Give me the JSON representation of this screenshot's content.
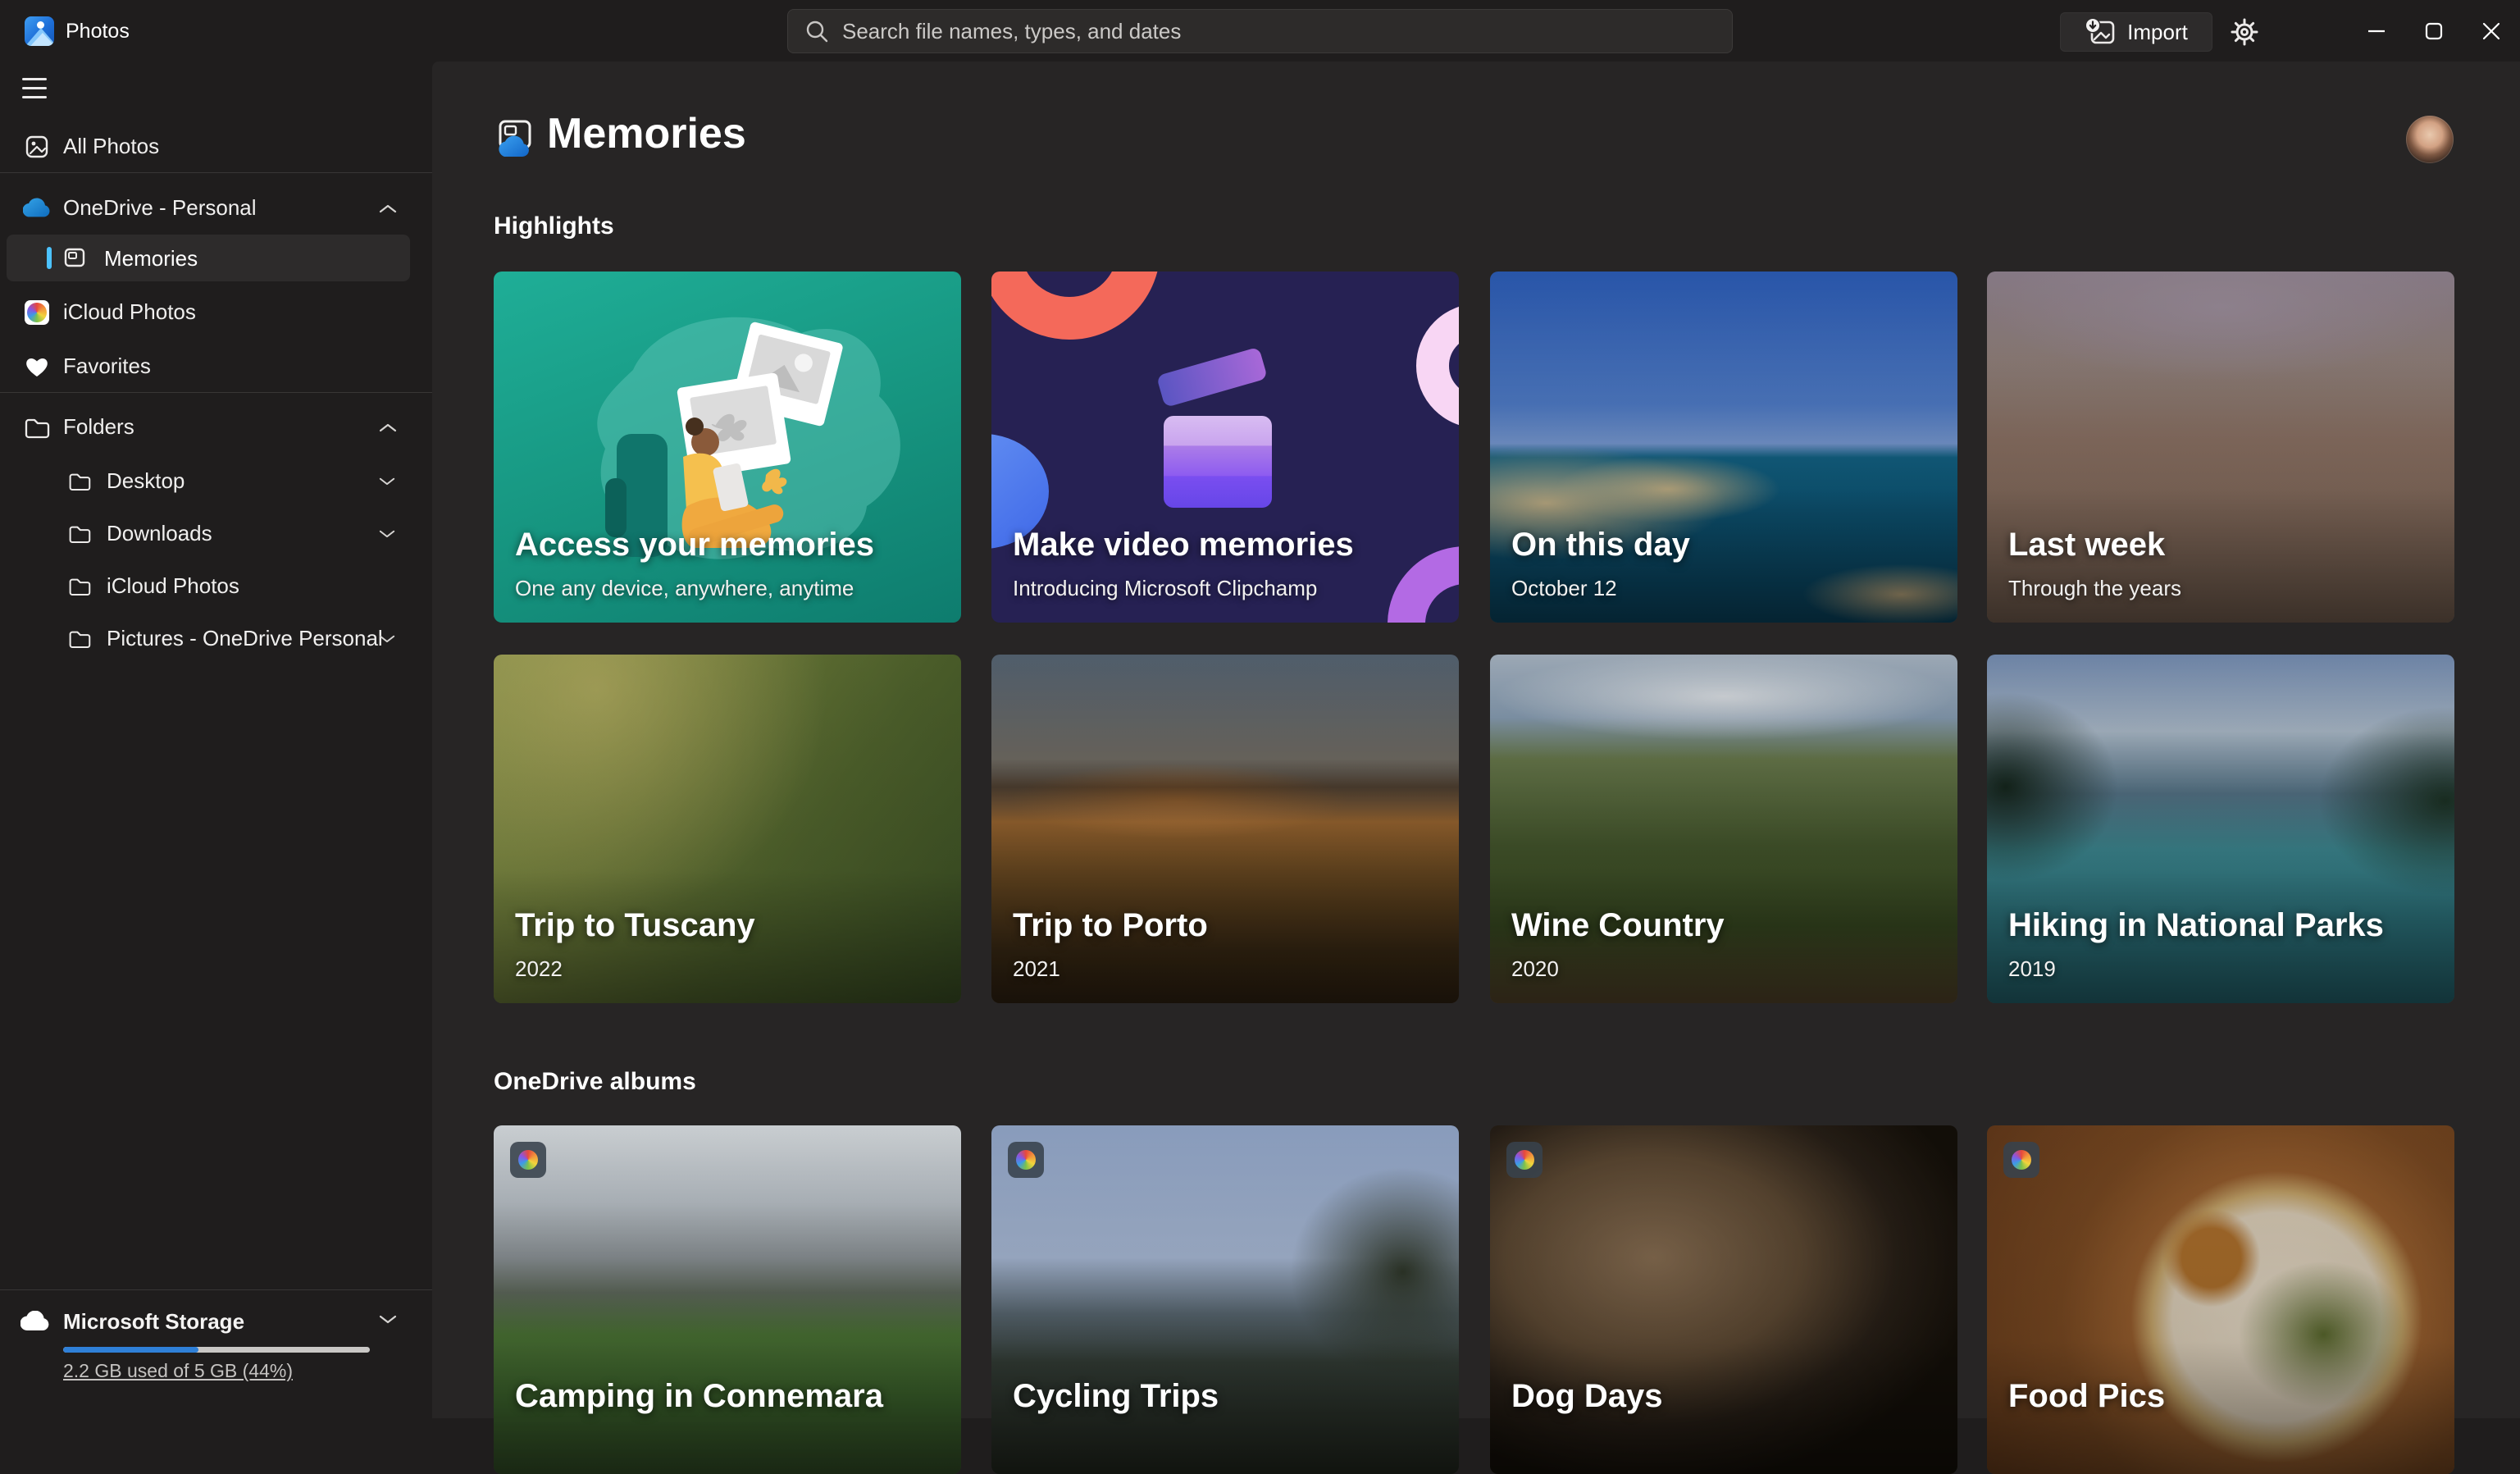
{
  "app": {
    "name": "Photos"
  },
  "titlebar": {
    "search": {
      "placeholder": "Search file names, types, and dates"
    },
    "import_button": {
      "label": "Import"
    }
  },
  "sidebar": {
    "items": {
      "all_photos": {
        "label": "All Photos"
      },
      "onedrive": {
        "label": "OneDrive - Personal",
        "expanded": true
      },
      "memories": {
        "label": "Memories",
        "selected": true
      },
      "icloud": {
        "label": "iCloud Photos"
      },
      "favorites": {
        "label": "Favorites"
      }
    },
    "folders": {
      "label": "Folders",
      "children": [
        {
          "label": "Desktop"
        },
        {
          "label": "Downloads"
        },
        {
          "label": "iCloud Photos"
        },
        {
          "label": "Pictures - OneDrive Personal"
        }
      ]
    },
    "storage": {
      "label": "Microsoft Storage",
      "usage": "2.2 GB used of 5 GB (44%)",
      "percent_used": 44,
      "bar_color": "#2f80d8"
    }
  },
  "page": {
    "title": "Memories",
    "highlights": {
      "label": "Highlights",
      "cards": [
        {
          "title": "Access your memories",
          "subtitle": "One any device, anywhere, anytime",
          "photo": "promo-onedrive-illustration"
        },
        {
          "title": "Make video memories",
          "subtitle": "Introducing Microsoft Clipchamp",
          "photo": "clipchamp-promo"
        },
        {
          "title": "On this day",
          "subtitle": "October 12",
          "photo": "coastal-cliffs-sea"
        },
        {
          "title": "Last week",
          "subtitle": "Through the years",
          "photo": "desert-trail-hiker"
        },
        {
          "title": "Trip to Tuscany",
          "subtitle": "2022",
          "photo": "tuscan-hillside"
        },
        {
          "title": "Trip to Porto",
          "subtitle": "2021",
          "photo": "porto-river-bridge"
        },
        {
          "title": "Wine Country",
          "subtitle": "2020",
          "photo": "vineyard-rows"
        },
        {
          "title": "Hiking in National Parks",
          "subtitle": "2019",
          "photo": "mountain-lake"
        }
      ]
    },
    "albums": {
      "label": "OneDrive albums",
      "cards": [
        {
          "title": "Camping in Connemara",
          "photo": "green-field-ponies"
        },
        {
          "title": "Cycling Trips",
          "photo": "bike-by-lake-fence"
        },
        {
          "title": "Dog Days",
          "photo": "dog-closeup"
        },
        {
          "title": "Food Pics",
          "photo": "plate-on-wood-table"
        }
      ]
    }
  },
  "colors": {
    "accent_selection": "#4cc2ff",
    "titlebar_bg": "#1f1d1d",
    "content_bg": "#272525",
    "promo_teal": "#16947f",
    "promo_clipchamp_bg": "#262153"
  },
  "icons": [
    "hamburger-icon",
    "search-icon",
    "import-icon",
    "gear-icon",
    "minimize-icon",
    "maximize-icon",
    "close-icon",
    "all-photos-icon",
    "onedrive-cloud-icon",
    "memories-icon",
    "icloud-photos-icon",
    "heart-icon",
    "folder-icon",
    "chevron-up-icon",
    "chevron-down-icon",
    "cloud-icon",
    "album-pinwheel-icon",
    "memories-page-icon"
  ]
}
